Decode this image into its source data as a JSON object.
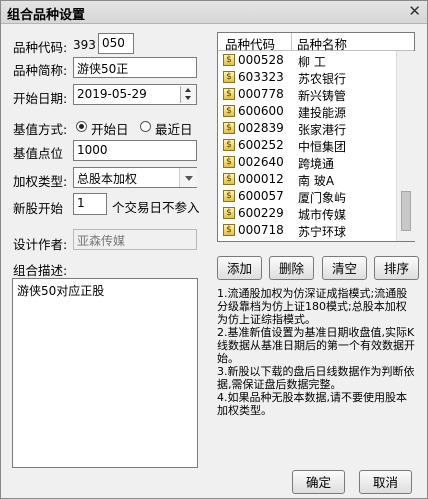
{
  "window": {
    "title": "组合品种设置",
    "close_glyph": "✕"
  },
  "form": {
    "code_label": "品种代码:",
    "code_prefix": "393",
    "code_value": "050",
    "short_name_label": "品种简称:",
    "short_name_value": "游侠50正",
    "start_date_label": "开始日期:",
    "start_date_value": "2019-05-29",
    "base_mode_label": "基值方式:",
    "base_mode_options": [
      "开始日",
      "最近日"
    ],
    "base_mode_selected": "开始日",
    "base_point_label": "基值点位",
    "base_point_value": "1000",
    "weight_type_label": "加权类型:",
    "weight_type_value": "总股本加权",
    "new_stock_label": "新股开始",
    "new_stock_value": "1",
    "new_stock_suffix": "个交易日不参入",
    "author_label": "设计作者:",
    "author_value": "亚森传媒",
    "desc_label": "组合描述:",
    "desc_value": "游侠50对应正股"
  },
  "list": {
    "headers": [
      "品种代码",
      "品种名称"
    ],
    "rows": [
      {
        "code": "000528",
        "name": "柳 工"
      },
      {
        "code": "603323",
        "name": "苏农银行"
      },
      {
        "code": "000778",
        "name": "新兴铸管"
      },
      {
        "code": "600600",
        "name": "建投能源"
      },
      {
        "code": "002839",
        "name": "张家港行"
      },
      {
        "code": "600252",
        "name": "中恒集团"
      },
      {
        "code": "002640",
        "name": "跨境通"
      },
      {
        "code": "000012",
        "name": "南 玻A"
      },
      {
        "code": "600057",
        "name": "厦门象屿"
      },
      {
        "code": "600229",
        "name": "城市传媒"
      },
      {
        "code": "000718",
        "name": "苏宁环球"
      }
    ]
  },
  "list_buttons": [
    "添加",
    "删除",
    "清空",
    "排序"
  ],
  "notes": [
    "1.流通股加权为仿深证成指模式;流通股分级靠档为仿上证180模式;总股本加权为仿上证综指模式。",
    "2.基准新值设置为基准日期收盘值,实际K线数据从基准日期后的第一个有效数据开始。",
    "3.新股以下载的盘后日线数据作为判断依据,需保证盘后数据完整。",
    "4.如果品种无股本数据,请不要使用股本加权类型。"
  ],
  "footer": {
    "ok": "确定",
    "cancel": "取消"
  }
}
